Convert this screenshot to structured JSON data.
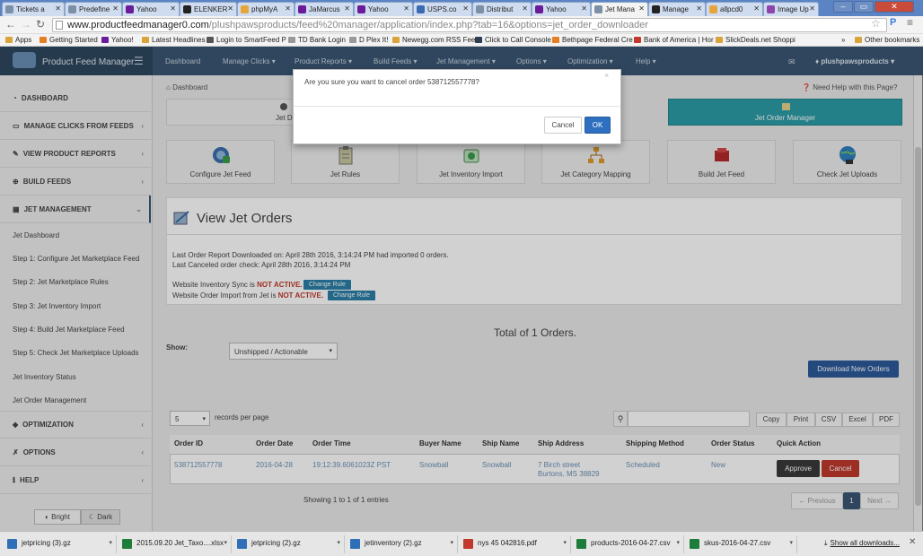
{
  "browser": {
    "tabs": [
      {
        "label": "Tickets a",
        "active": false
      },
      {
        "label": "Predefine",
        "active": false
      },
      {
        "label": "Yahoo",
        "active": false
      },
      {
        "label": "ELENKER",
        "active": false
      },
      {
        "label": "phpMyA",
        "active": false
      },
      {
        "label": "JaMarcus",
        "active": false
      },
      {
        "label": "Yahoo",
        "active": false
      },
      {
        "label": "USPS.co",
        "active": false
      },
      {
        "label": "Distribut",
        "active": false
      },
      {
        "label": "Yahoo",
        "active": false
      },
      {
        "label": "Jet Mana",
        "active": true
      },
      {
        "label": "Manage",
        "active": false
      },
      {
        "label": "allpcd0",
        "active": false
      },
      {
        "label": "Image Up",
        "active": false
      }
    ],
    "url_host": "www.productfeedmanager0.com",
    "url_path": "/plushpawsproducts/feed%20manager/application/index.php?tab=16&options=jet_order_downloader",
    "bookmarks": [
      {
        "label": "Apps",
        "color": "#c0392b"
      },
      {
        "label": "Getting Started",
        "color": "#e67e22"
      },
      {
        "label": "Yahoo!",
        "color": "#6a1b9a"
      },
      {
        "label": "Latest Headlines",
        "color": "#d9a43a"
      },
      {
        "label": "Login to SmartFeed P",
        "color": "#555555"
      },
      {
        "label": "TD Bank Login",
        "color": "#999999"
      },
      {
        "label": "D Plex It!",
        "color": "#999999"
      },
      {
        "label": "Newegg.com RSS Fee",
        "color": "#d9a43a"
      },
      {
        "label": "Click to Call Console",
        "color": "#2c3e50"
      },
      {
        "label": "Bethpage Federal Cre",
        "color": "#e67e22"
      },
      {
        "label": "Bank of America | Hor",
        "color": "#c0392b"
      },
      {
        "label": "SlickDeals.net Shoppi",
        "color": "#d9a43a"
      },
      {
        "label": "»",
        "color": "transparent"
      },
      {
        "label": "Other bookmarks",
        "color": "#d9a43a"
      }
    ]
  },
  "app": {
    "brand": "Product Feed Manager",
    "menu_icon": "hamburger-icon",
    "nav": [
      "Dashboard",
      "Manage Clicks ▾",
      "Product Reports ▾",
      "Build Feeds ▾",
      "Jet Management ▾",
      "Options ▾",
      "Optimization ▾",
      "Help ▾"
    ],
    "user": "plushpawsproducts ▾",
    "breadcrumb": "Dashboard",
    "help_link": "Need Help with this Page?"
  },
  "sidebar": {
    "main": [
      {
        "label": "DASHBOARD",
        "icon": "dashboard-icon"
      },
      {
        "label": "MANAGE CLICKS FROM FEEDS",
        "icon": "monitor-icon"
      },
      {
        "label": "VIEW PRODUCT REPORTS",
        "icon": "edit-icon"
      },
      {
        "label": "BUILD FEEDS",
        "icon": "build-icon"
      },
      {
        "label": "JET MANAGEMENT",
        "icon": "grid-icon"
      }
    ],
    "sub": [
      "Jet Dashboard",
      "Step 1: Configure Jet Marketplace Feed",
      "Step 2: Jet Marketplace Rules",
      "Step 3: Jet Inventory Import",
      "Step 4: Build Jet Marketplace Feed",
      "Step 5: Check Jet Marketplace Uploads",
      "Jet Inventory Status",
      "Jet Order Management"
    ],
    "bottom": [
      {
        "label": "OPTIMIZATION",
        "icon": "tag-icon"
      },
      {
        "label": "OPTIONS",
        "icon": "wrench-icon"
      },
      {
        "label": "HELP",
        "icon": "info-icon"
      }
    ],
    "theme_bright": "Bright",
    "theme_dark": "Dark"
  },
  "top_buttons": {
    "left": "Jet Dashb",
    "right": "Jet Order Manager"
  },
  "tiles": [
    {
      "label": "Configure Jet Feed",
      "icon": "configure-feed-icon"
    },
    {
      "label": "Jet Rules",
      "icon": "clipboard-icon"
    },
    {
      "label": "Jet Inventory Import",
      "icon": "inventory-import-icon"
    },
    {
      "label": "Jet Category Mapping",
      "icon": "category-mapping-icon"
    },
    {
      "label": "Build Jet Feed",
      "icon": "build-feed-icon"
    },
    {
      "label": "Check Jet Uploads",
      "icon": "globe-upload-icon"
    }
  ],
  "orders_panel": {
    "title": "View Jet Orders",
    "last_download": "Last Order Report Downloaded on: April 28th 2016, 3:14:24 PM had imported 0 orders.",
    "last_cancel": "Last Canceled order check: April 28th 2016, 3:14:24 PM",
    "inv_sync_prefix": "Website Inventory Sync is ",
    "inv_sync_status": "NOT ACTIVE.",
    "order_import_prefix": "Website Order Import from Jet is ",
    "order_import_status": "NOT ACTIVE.",
    "change_rule": "Change Rule"
  },
  "total": "Total of 1 Orders.",
  "show_label": "Show:",
  "show_value": "Unshipped / Actionable",
  "download_btn": "Download New Orders",
  "records": {
    "value": "5",
    "label": "records per page"
  },
  "export_buttons": [
    "Copy",
    "Print",
    "CSV",
    "Excel",
    "PDF"
  ],
  "table": {
    "headers": [
      "Order ID",
      "Order Date",
      "Order Time",
      "Buyer Name",
      "Ship Name",
      "Ship Address",
      "Shipping Method",
      "Order Status",
      "Quick Action"
    ],
    "row": {
      "order_id": "538712557778",
      "order_date": "2016-04-28",
      "order_time": "19:12:39.6061023Z PST",
      "buyer_name": "Snowball",
      "ship_name": "Snowball",
      "address_1": "7 Birch street",
      "address_2": "Burtons, MS 38829",
      "shipping_method": "Scheduled",
      "order_status": "New",
      "approve": "Approve",
      "cancel": "Cancel"
    }
  },
  "pagination": {
    "info": "Showing 1 to 1 of 1 entries",
    "previous": "← Previous",
    "page": "1",
    "next": "Next →"
  },
  "modal": {
    "message": "Are you sure you want to cancel order 538712557778?",
    "close": "×",
    "cancel": "Cancel",
    "ok": "OK"
  },
  "downloads": [
    {
      "label": "jetpricing (3).gz",
      "icon_color": "#2e6fb7"
    },
    {
      "label": "2015.09.20 Jet_Taxo....xlsx",
      "icon_color": "#1e7d3a"
    },
    {
      "label": "jetpricing (2).gz",
      "icon_color": "#2e6fb7"
    },
    {
      "label": "jetinventory (2).gz",
      "icon_color": "#2e6fb7"
    },
    {
      "label": "nys 45 042816.pdf",
      "icon_color": "#c0392b"
    },
    {
      "label": "products-2016-04-27.csv",
      "icon_color": "#1e7d3a"
    },
    {
      "label": "skus-2016-04-27.csv",
      "icon_color": "#1e7d3a"
    }
  ],
  "show_all_downloads": "Show all downloads..."
}
